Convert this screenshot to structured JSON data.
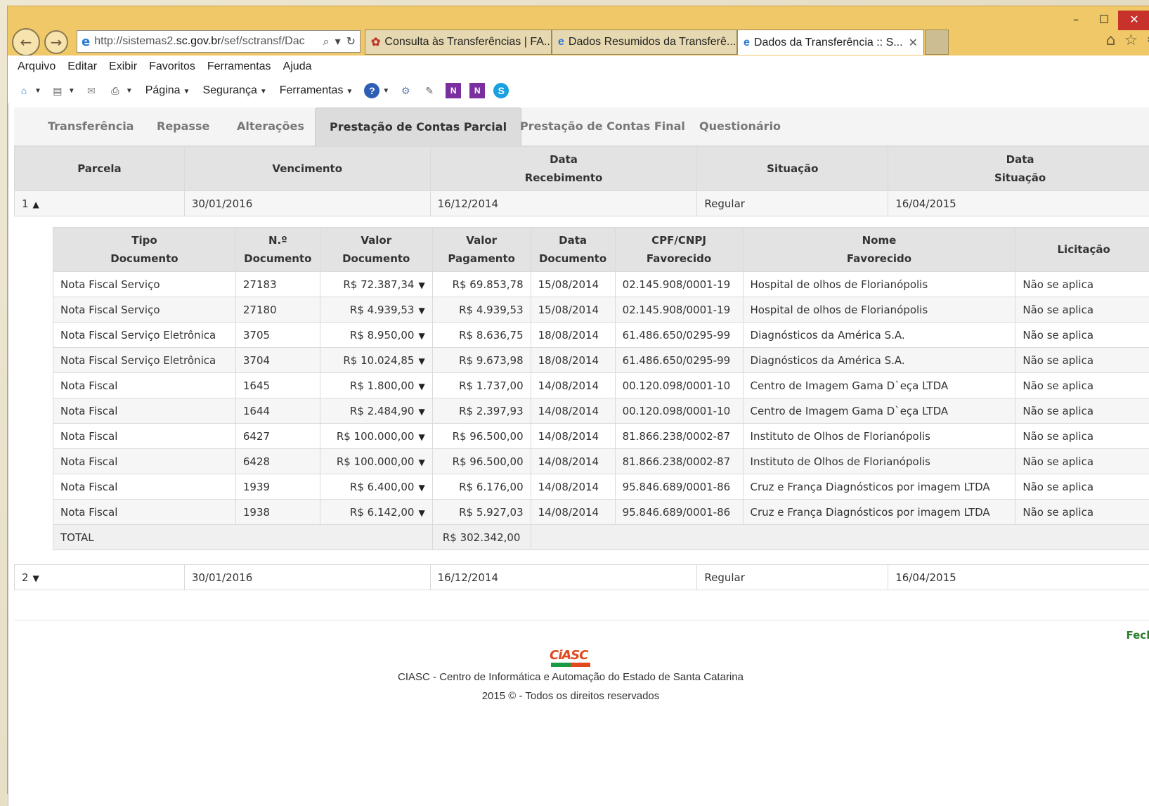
{
  "window": {
    "minimize": "–",
    "maximize": "☐",
    "close": "✕"
  },
  "browser": {
    "url_host_prefix": "http://sistemas2.",
    "url_host": "sc.gov.br",
    "url_path": "/sef/sctransf/Dac",
    "tabs": [
      {
        "label": "Consulta às Transferências | FA..."
      },
      {
        "label": "Dados Resumidos da Transferê..."
      },
      {
        "label": "Dados da Transferência :: S..."
      }
    ],
    "close_tab": "✕"
  },
  "menu": [
    "Arquivo",
    "Editar",
    "Exibir",
    "Favoritos",
    "Ferramentas",
    "Ajuda"
  ],
  "command_bar": {
    "pagina": "Página",
    "seguranca": "Segurança",
    "ferramentas": "Ferramentas"
  },
  "page_tabs": [
    "Transferência",
    "Repasse",
    "Alterações",
    "Prestação de Contas Parcial",
    "Prestação de Contas Final",
    "Questionário"
  ],
  "outer_table": {
    "headers": {
      "parcela": "Parcela",
      "vencimento": "Vencimento",
      "data_recebimento_1": "Data",
      "data_recebimento_2": "Recebimento",
      "situacao": "Situação",
      "data_situacao_1": "Data",
      "data_situacao_2": "Situação"
    },
    "rows": [
      {
        "parcela": "1",
        "vencimento": "30/01/2016",
        "recebimento": "16/12/2014",
        "situacao": "Regular",
        "data_situacao": "16/04/2015"
      },
      {
        "parcela": "2",
        "vencimento": "30/01/2016",
        "recebimento": "16/12/2014",
        "situacao": "Regular",
        "data_situacao": "16/04/2015"
      }
    ]
  },
  "inner_table": {
    "headers": {
      "tipo_1": "Tipo",
      "tipo_2": "Documento",
      "num_1": "N.º",
      "num_2": "Documento",
      "valor_doc_1": "Valor",
      "valor_doc_2": "Documento",
      "valor_pag_1": "Valor",
      "valor_pag_2": "Pagamento",
      "data_doc_1": "Data",
      "data_doc_2": "Documento",
      "cpf_1": "CPF/CNPJ",
      "cpf_2": "Favorecido",
      "nome_1": "Nome",
      "nome_2": "Favorecido",
      "licitacao": "Licitação"
    },
    "rows": [
      {
        "tipo": "Nota Fiscal Serviço",
        "num": "27183",
        "valor_doc": "R$ 72.387,34",
        "valor_pag": "R$ 69.853,78",
        "data": "15/08/2014",
        "cpf": "02.145.908/0001-19",
        "nome": "Hospital de olhos de Florianópolis",
        "licitacao": "Não se aplica"
      },
      {
        "tipo": "Nota Fiscal Serviço",
        "num": "27180",
        "valor_doc": "R$ 4.939,53",
        "valor_pag": "R$ 4.939,53",
        "data": "15/08/2014",
        "cpf": "02.145.908/0001-19",
        "nome": "Hospital de olhos de Florianópolis",
        "licitacao": "Não se aplica"
      },
      {
        "tipo": "Nota Fiscal Serviço Eletrônica",
        "num": "3705",
        "valor_doc": "R$ 8.950,00",
        "valor_pag": "R$ 8.636,75",
        "data": "18/08/2014",
        "cpf": "61.486.650/0295-99",
        "nome": "Diagnósticos da América S.A.",
        "licitacao": "Não se aplica"
      },
      {
        "tipo": "Nota Fiscal Serviço Eletrônica",
        "num": "3704",
        "valor_doc": "R$ 10.024,85",
        "valor_pag": "R$ 9.673,98",
        "data": "18/08/2014",
        "cpf": "61.486.650/0295-99",
        "nome": "Diagnósticos da América S.A.",
        "licitacao": "Não se aplica"
      },
      {
        "tipo": "Nota Fiscal",
        "num": "1645",
        "valor_doc": "R$ 1.800,00",
        "valor_pag": "R$ 1.737,00",
        "data": "14/08/2014",
        "cpf": "00.120.098/0001-10",
        "nome": "Centro de Imagem Gama D`eça LTDA",
        "licitacao": "Não se aplica"
      },
      {
        "tipo": "Nota Fiscal",
        "num": "1644",
        "valor_doc": "R$ 2.484,90",
        "valor_pag": "R$ 2.397,93",
        "data": "14/08/2014",
        "cpf": "00.120.098/0001-10",
        "nome": "Centro de Imagem Gama D`eça LTDA",
        "licitacao": "Não se aplica"
      },
      {
        "tipo": "Nota Fiscal",
        "num": "6427",
        "valor_doc": "R$ 100.000,00",
        "valor_pag": "R$ 96.500,00",
        "data": "14/08/2014",
        "cpf": "81.866.238/0002-87",
        "nome": "Instituto de Olhos de Florianópolis",
        "licitacao": "Não se aplica"
      },
      {
        "tipo": "Nota Fiscal",
        "num": "6428",
        "valor_doc": "R$ 100.000,00",
        "valor_pag": "R$ 96.500,00",
        "data": "14/08/2014",
        "cpf": "81.866.238/0002-87",
        "nome": "Instituto de Olhos de Florianópolis",
        "licitacao": "Não se aplica"
      },
      {
        "tipo": "Nota Fiscal",
        "num": "1939",
        "valor_doc": "R$ 6.400,00",
        "valor_pag": "R$ 6.176,00",
        "data": "14/08/2014",
        "cpf": "95.846.689/0001-86",
        "nome": "Cruz e França Diagnósticos por imagem LTDA",
        "licitacao": "Não se aplica"
      },
      {
        "tipo": "Nota Fiscal",
        "num": "1938",
        "valor_doc": "R$ 6.142,00",
        "valor_pag": "R$ 5.927,03",
        "data": "14/08/2014",
        "cpf": "95.846.689/0001-86",
        "nome": "Cruz e França Diagnósticos por imagem LTDA",
        "licitacao": "Não se aplica"
      }
    ],
    "total_label": "TOTAL",
    "total_value": "R$ 302.342,00"
  },
  "footer": {
    "fechar": "Fecha",
    "logo_text": "CiASC",
    "org": "CIASC - Centro de Informática e Automação do Estado de Santa Catarina",
    "rights": "2015 © - Todos os direitos reservados"
  }
}
